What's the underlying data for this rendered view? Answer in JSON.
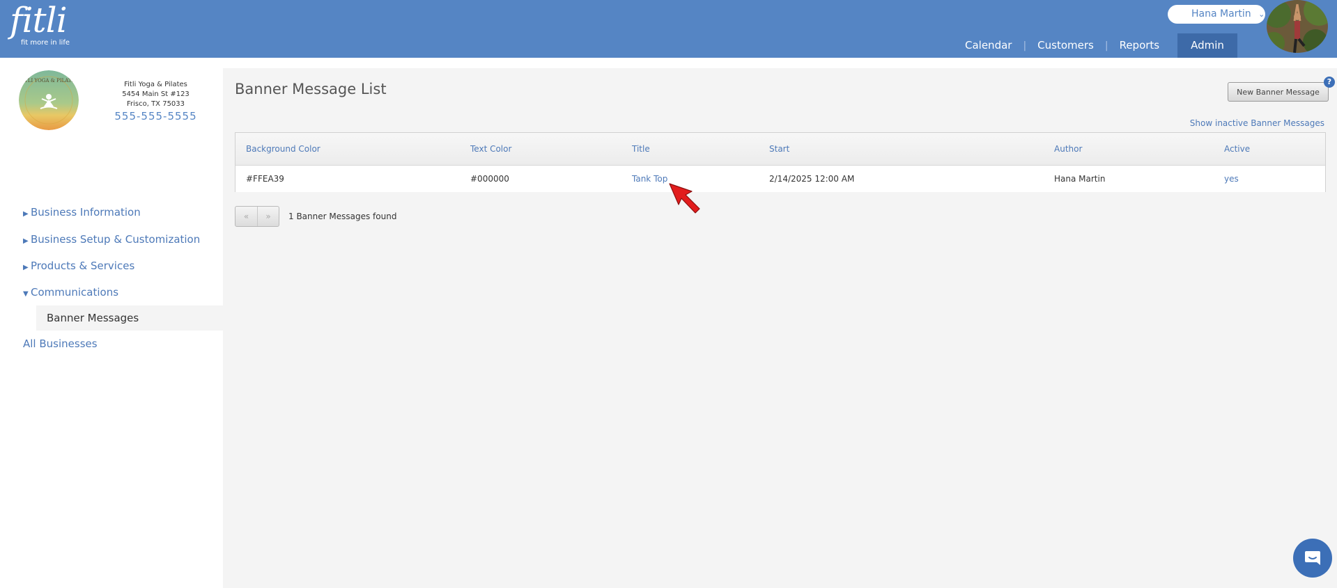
{
  "brand": {
    "logo_text": "fitli",
    "tagline": "fit more in life"
  },
  "user": {
    "name": "Hana Martin",
    "chevron": "chevron-down-icon"
  },
  "nav": {
    "items": [
      {
        "label": "Calendar"
      },
      {
        "label": "Customers"
      },
      {
        "label": "Reports"
      },
      {
        "label": "Admin",
        "active": true
      }
    ],
    "separator": "|"
  },
  "business": {
    "name": "Fitli Yoga & Pilates",
    "address_line1": "5454 Main St #123",
    "address_line2": "Frisco, TX 75033",
    "phone": "555-555-5555",
    "logo_text": "FITLI YOGA & PILATES"
  },
  "sidebar": {
    "items": [
      {
        "label": "Business Information",
        "caret": "▶"
      },
      {
        "label": "Business Setup & Customization",
        "caret": "▶"
      },
      {
        "label": "Products & Services",
        "caret": "▶"
      },
      {
        "label": "Communications",
        "caret": "▼"
      }
    ],
    "active_subitem": "Banner Messages",
    "all_businesses": "All Businesses"
  },
  "main": {
    "title": "Banner Message List",
    "new_button": "New Banner Message",
    "help_icon": "?",
    "inactive_link": "Show inactive Banner Messages",
    "table": {
      "columns": [
        "Background Color",
        "Text Color",
        "Title",
        "Start",
        "Author",
        "Active"
      ],
      "rows": [
        {
          "background_color": "#FFEA39",
          "text_color": "#000000",
          "title": "Tank Top",
          "start": "2/14/2025 12:00 AM",
          "author": "Hana Martin",
          "active": "yes"
        }
      ]
    },
    "pager": {
      "prev": "«",
      "next": "»"
    },
    "found_text": "1 Banner Messages found"
  },
  "colors": {
    "header": "#5585c4",
    "link": "#4d79b8",
    "admin_active": "#3d6aa8",
    "content_bg": "#f4f4f4"
  }
}
